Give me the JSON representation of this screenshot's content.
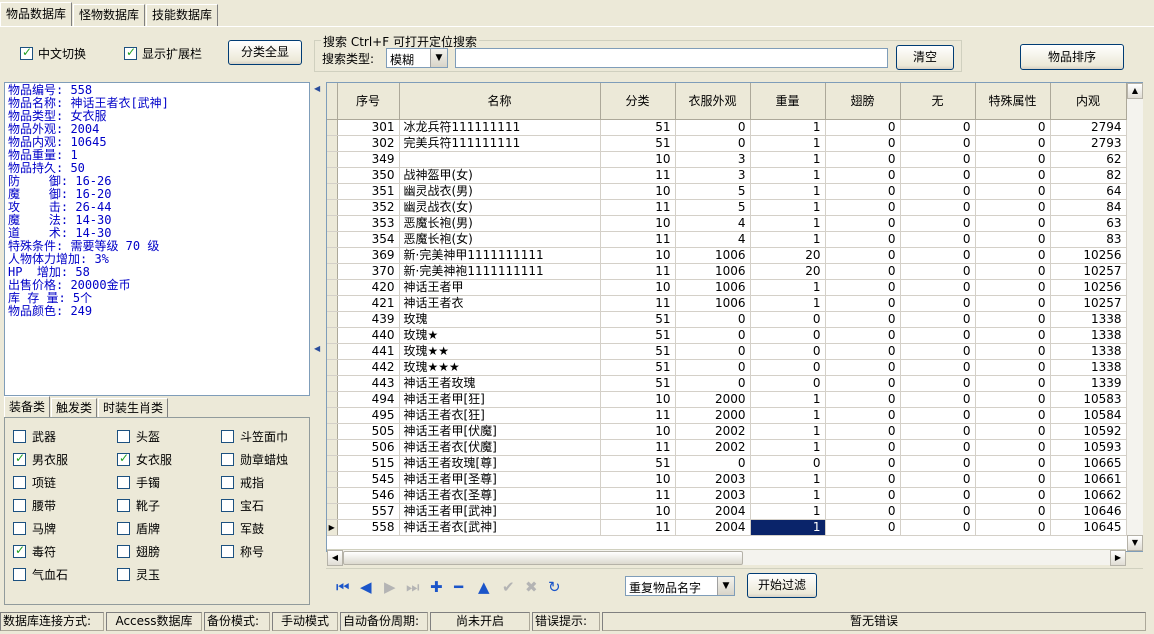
{
  "tabs": [
    "物品数据库",
    "怪物数据库",
    "技能数据库"
  ],
  "options": {
    "chinese_switch": {
      "label": "中文切换",
      "checked": true
    },
    "show_extension": {
      "label": "显示扩展栏",
      "checked": true
    },
    "show_all_label": "分类全显"
  },
  "search": {
    "group_title": "搜索  Ctrl+F 可打开定位搜索",
    "type_label": "搜索类型:",
    "type_value": "模糊",
    "input_value": "",
    "clear_label": "清空"
  },
  "sort_label": "物品排序",
  "info_lines": [
    "物品编号: 558",
    "物品名称: 神话王者衣[武神]",
    "物品类型: 女衣服",
    "物品外观: 2004",
    "物品内观: 10645",
    "物品重量: 1",
    "物品持久: 50",
    "防    御: 16-26",
    "魔    御: 16-20",
    "攻    击: 26-44",
    "魔    法: 14-30",
    "道    术: 14-30",
    "特殊条件: 需要等级 70 级",
    "人物体力增加: 3%",
    "HP  增加: 58",
    "出售价格: 20000金币",
    "库 存 量: 5个",
    "物品颜色: 249"
  ],
  "sub_tabs": [
    "装备类",
    "触发类",
    "时装生肖类"
  ],
  "categories": [
    {
      "label": "武器",
      "checked": false
    },
    {
      "label": "头盔",
      "checked": false
    },
    {
      "label": "斗笠面巾",
      "checked": false
    },
    {
      "label": "男衣服",
      "checked": true
    },
    {
      "label": "女衣服",
      "checked": true
    },
    {
      "label": "勋章蜡烛",
      "checked": false
    },
    {
      "label": "项链",
      "checked": false
    },
    {
      "label": "手镯",
      "checked": false
    },
    {
      "label": "戒指",
      "checked": false
    },
    {
      "label": "腰带",
      "checked": false
    },
    {
      "label": "靴子",
      "checked": false
    },
    {
      "label": "宝石",
      "checked": false
    },
    {
      "label": "马牌",
      "checked": false
    },
    {
      "label": "盾牌",
      "checked": false
    },
    {
      "label": "军鼓",
      "checked": false
    },
    {
      "label": "毒符",
      "checked": true
    },
    {
      "label": "翅膀",
      "checked": false
    },
    {
      "label": "称号",
      "checked": false
    },
    {
      "label": "气血石",
      "checked": false
    },
    {
      "label": "灵玉",
      "checked": false
    }
  ],
  "grid": {
    "columns": [
      "序号",
      "名称",
      "分类",
      "衣服外观",
      "重量",
      "翅膀",
      "无",
      "特殊属性",
      "内观"
    ],
    "rows": [
      [
        "301",
        "冰龙兵符111111111",
        "51",
        "0",
        "1",
        "0",
        "0",
        "0",
        "2794"
      ],
      [
        "302",
        "完美兵符111111111",
        "51",
        "0",
        "1",
        "0",
        "0",
        "0",
        "2793"
      ],
      [
        "349",
        "",
        "10",
        "3",
        "1",
        "0",
        "0",
        "0",
        "62"
      ],
      [
        "350",
        "战神盔甲(女)",
        "11",
        "3",
        "1",
        "0",
        "0",
        "0",
        "82"
      ],
      [
        "351",
        "幽灵战衣(男)",
        "10",
        "5",
        "1",
        "0",
        "0",
        "0",
        "64"
      ],
      [
        "352",
        "幽灵战衣(女)",
        "11",
        "5",
        "1",
        "0",
        "0",
        "0",
        "84"
      ],
      [
        "353",
        "恶魔长袍(男)",
        "10",
        "4",
        "1",
        "0",
        "0",
        "0",
        "63"
      ],
      [
        "354",
        "恶魔长袍(女)",
        "11",
        "4",
        "1",
        "0",
        "0",
        "0",
        "83"
      ],
      [
        "369",
        "新·完美神甲1111111111",
        "10",
        "1006",
        "20",
        "0",
        "0",
        "0",
        "10256"
      ],
      [
        "370",
        "新·完美神袍1111111111",
        "11",
        "1006",
        "20",
        "0",
        "0",
        "0",
        "10257"
      ],
      [
        "420",
        "神话王者甲",
        "10",
        "1006",
        "1",
        "0",
        "0",
        "0",
        "10256"
      ],
      [
        "421",
        "神话王者衣",
        "11",
        "1006",
        "1",
        "0",
        "0",
        "0",
        "10257"
      ],
      [
        "439",
        "玫瑰",
        "51",
        "0",
        "0",
        "0",
        "0",
        "0",
        "1338"
      ],
      [
        "440",
        "玫瑰★",
        "51",
        "0",
        "0",
        "0",
        "0",
        "0",
        "1338"
      ],
      [
        "441",
        "玫瑰★★",
        "51",
        "0",
        "0",
        "0",
        "0",
        "0",
        "1338"
      ],
      [
        "442",
        "玫瑰★★★",
        "51",
        "0",
        "0",
        "0",
        "0",
        "0",
        "1338"
      ],
      [
        "443",
        "神话王者玫瑰",
        "51",
        "0",
        "0",
        "0",
        "0",
        "0",
        "1339"
      ],
      [
        "494",
        "神话王者甲[狂]",
        "10",
        "2000",
        "1",
        "0",
        "0",
        "0",
        "10583"
      ],
      [
        "495",
        "神话王者衣[狂]",
        "11",
        "2000",
        "1",
        "0",
        "0",
        "0",
        "10584"
      ],
      [
        "505",
        "神话王者甲[伏魔]",
        "10",
        "2002",
        "1",
        "0",
        "0",
        "0",
        "10592"
      ],
      [
        "506",
        "神话王者衣[伏魔]",
        "11",
        "2002",
        "1",
        "0",
        "0",
        "0",
        "10593"
      ],
      [
        "515",
        "神话王者玫瑰[尊]",
        "51",
        "0",
        "0",
        "0",
        "0",
        "0",
        "10665"
      ],
      [
        "545",
        "神话王者甲[圣尊]",
        "10",
        "2003",
        "1",
        "0",
        "0",
        "0",
        "10661"
      ],
      [
        "546",
        "神话王者衣[圣尊]",
        "11",
        "2003",
        "1",
        "0",
        "0",
        "0",
        "10662"
      ],
      [
        "557",
        "神话王者甲[武神]",
        "10",
        "2004",
        "1",
        "0",
        "0",
        "0",
        "10646"
      ],
      [
        "558",
        "神话王者衣[武神]",
        "11",
        "2004",
        "1",
        "0",
        "0",
        "0",
        "10645"
      ]
    ],
    "selected_row": 25
  },
  "filter": {
    "value": "重复物品名字",
    "button_label": "开始过滤"
  },
  "status": {
    "conn_label": "数据库连接方式:",
    "conn_value": "Access数据库",
    "backup_label": "备份模式:",
    "backup_value": "手动模式",
    "period_label": "自动备份周期:",
    "period_value": "尚未开启",
    "error_label": "错误提示:",
    "error_value": "暂无错误"
  }
}
